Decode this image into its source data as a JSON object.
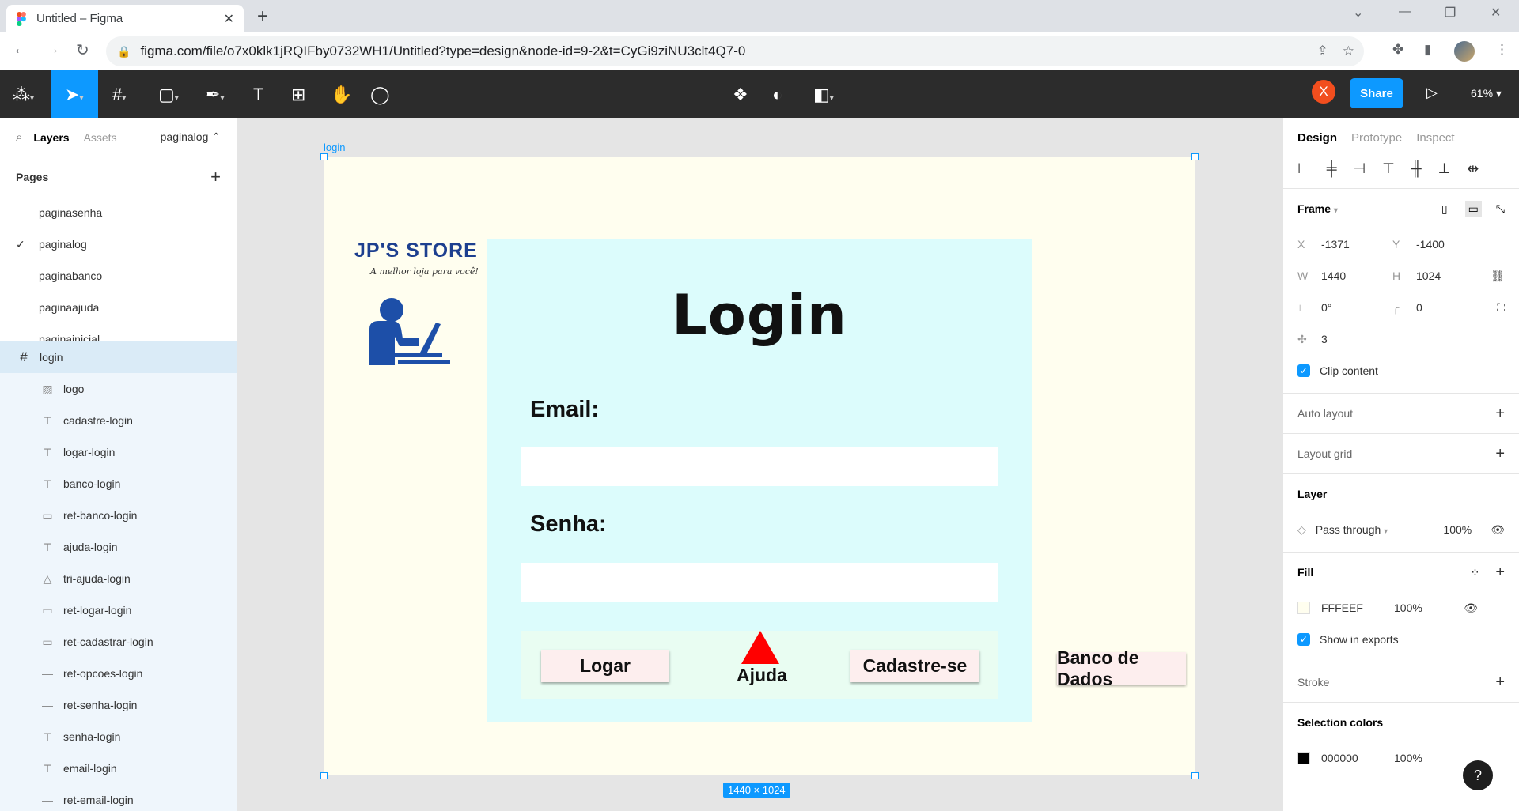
{
  "browser": {
    "tab_title": "Untitled – Figma",
    "url": "figma.com/file/o7x0klk1jRQIFby0732WH1/Untitled?type=design&node-id=9-2&t=CyGi9ziNU3clt4Q7-0"
  },
  "toolbar": {
    "user_initial": "X",
    "share_label": "Share",
    "zoom": "61%"
  },
  "left_panel": {
    "tab_layers": "Layers",
    "tab_assets": "Assets",
    "current_page": "paginalog",
    "pages_header": "Pages",
    "pages": [
      "paginasenha",
      "paginalog",
      "paginabanco",
      "paginaajuda",
      "paginainicial"
    ],
    "frame_name": "login",
    "layers": [
      {
        "name": "logo",
        "icon": "image-icon"
      },
      {
        "name": "cadastre-login",
        "icon": "text-icon"
      },
      {
        "name": "logar-login",
        "icon": "text-icon"
      },
      {
        "name": "banco-login",
        "icon": "text-icon"
      },
      {
        "name": "ret-banco-login",
        "icon": "rectangle-icon"
      },
      {
        "name": "ajuda-login",
        "icon": "text-icon"
      },
      {
        "name": "tri-ajuda-login",
        "icon": "triangle-icon"
      },
      {
        "name": "ret-logar-login",
        "icon": "rectangle-icon"
      },
      {
        "name": "ret-cadastrar-login",
        "icon": "rectangle-icon"
      },
      {
        "name": "ret-opcoes-login",
        "icon": "line-icon"
      },
      {
        "name": "ret-senha-login",
        "icon": "line-icon"
      },
      {
        "name": "senha-login",
        "icon": "text-icon"
      },
      {
        "name": "email-login",
        "icon": "text-icon"
      },
      {
        "name": "ret-email-login",
        "icon": "line-icon"
      }
    ]
  },
  "canvas": {
    "frame_label": "login",
    "size_badge": "1440 × 1024",
    "logo_title": "JP'S STORE",
    "logo_subtitle": "A melhor loja para você!",
    "login_title": "Login",
    "email_label": "Email:",
    "senha_label": "Senha:",
    "btn_logar": "Logar",
    "btn_ajuda": "Ajuda",
    "btn_cadastre": "Cadastre-se",
    "btn_banco": "Banco de Dados",
    "colors": {
      "frame_bg": "#FFFEEF",
      "panel_bg": "#DCFCFC",
      "triangle": "#FF0000",
      "logo_blue": "#1D3F8F"
    }
  },
  "right_panel": {
    "tab_design": "Design",
    "tab_prototype": "Prototype",
    "tab_inspect": "Inspect",
    "frame_label": "Frame",
    "x_label": "X",
    "x_value": "-1371",
    "y_label": "Y",
    "y_value": "-1400",
    "w_label": "W",
    "w_value": "1440",
    "h_label": "H",
    "h_value": "1024",
    "rotation": "0°",
    "radius": "0",
    "spacing": "3",
    "clip_content": "Clip content",
    "auto_layout": "Auto layout",
    "layout_grid": "Layout grid",
    "layer_header": "Layer",
    "blend_mode": "Pass through",
    "layer_opacity": "100%",
    "fill_header": "Fill",
    "fill_hex": "FFFEEF",
    "fill_opacity": "100%",
    "show_in_exports": "Show in exports",
    "stroke": "Stroke",
    "selection_colors": "Selection colors",
    "sel_hex": "000000",
    "sel_opacity": "100%"
  }
}
